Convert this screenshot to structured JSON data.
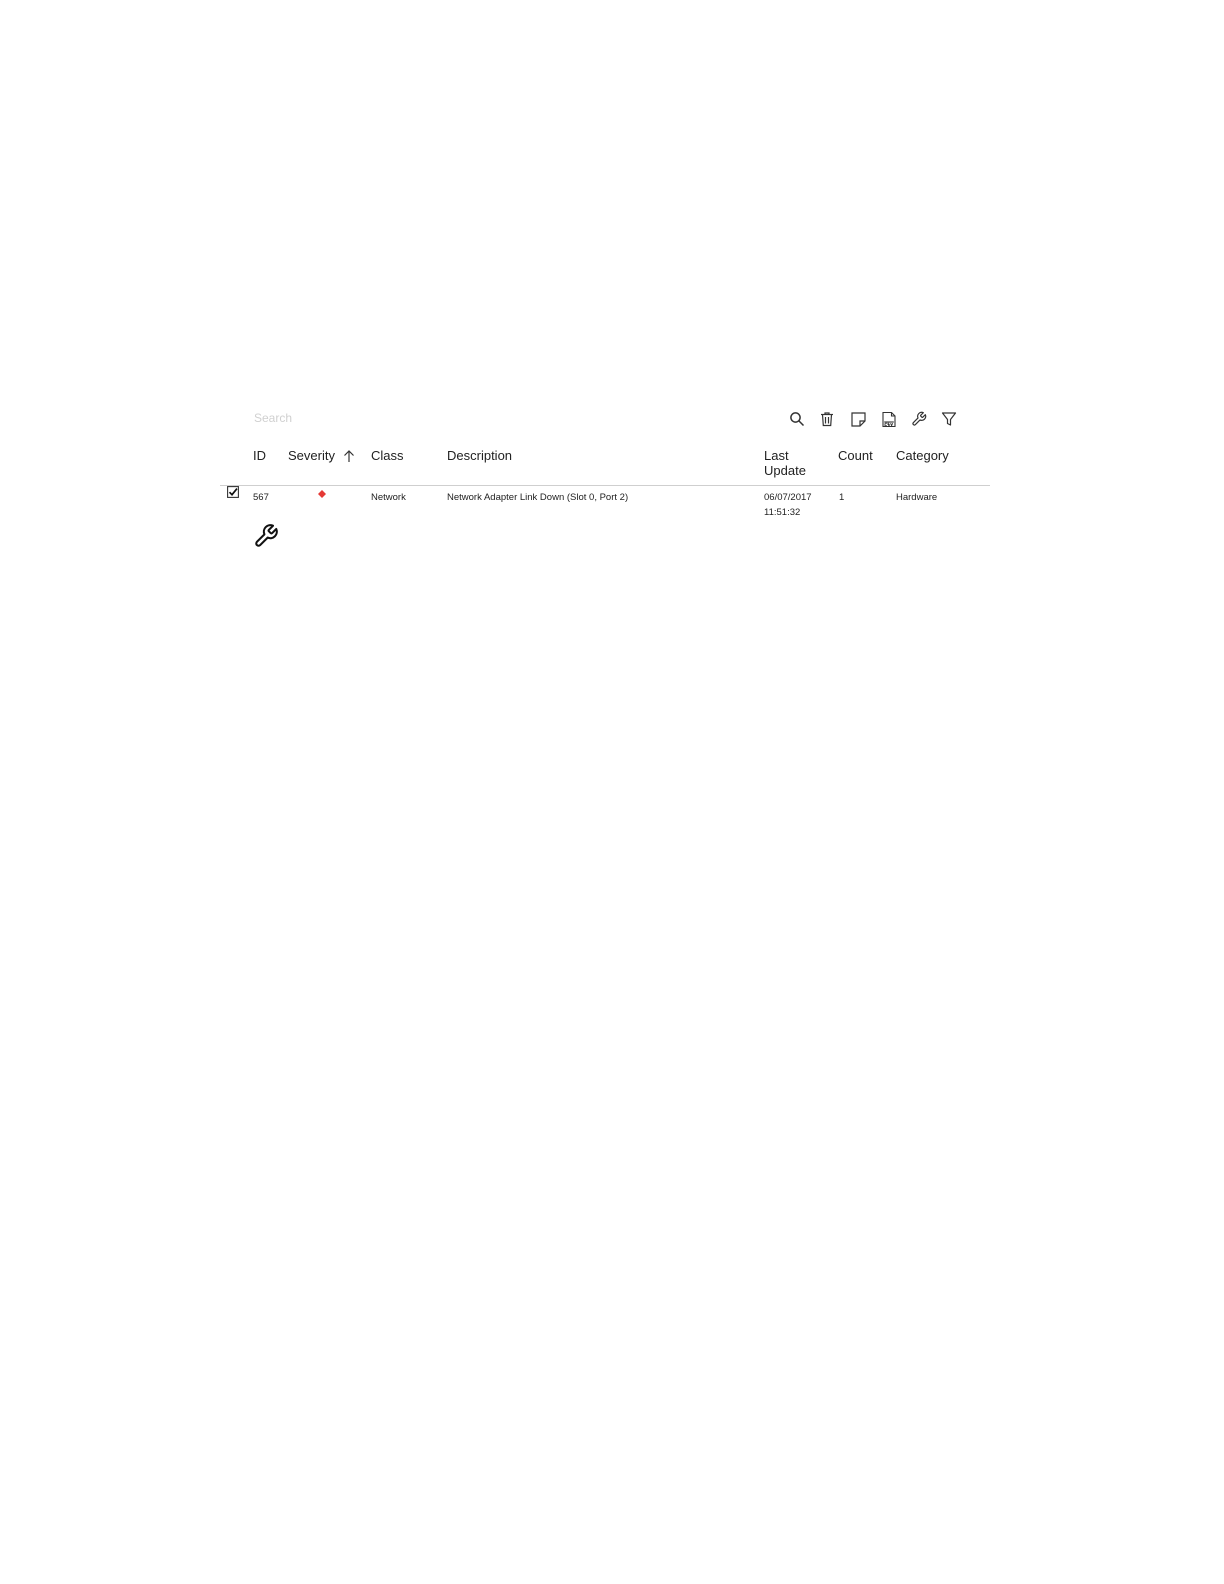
{
  "search": {
    "placeholder": "Search"
  },
  "toolbar": {
    "icons": [
      "search-icon",
      "trash-icon",
      "note-icon",
      "csv-export-icon",
      "wrench-icon",
      "filter-icon"
    ]
  },
  "table": {
    "columns": [
      "ID",
      "Severity",
      "Class",
      "Description",
      "Last Update",
      "Count",
      "Category"
    ],
    "sort": {
      "column": "Severity",
      "direction": "ascending"
    },
    "rows": [
      {
        "checked": true,
        "id": "567",
        "severity_icon": "critical-diamond-icon",
        "class": "Network",
        "description": "Network Adapter Link Down (Slot 0, Port 2)",
        "last_update": "06/07/2017 11:51:32",
        "count": "1",
        "category": "Hardware"
      }
    ]
  },
  "colors": {
    "severity_critical": "#e53935",
    "header_rule": "#cfcfcf",
    "placeholder": "#d0d0d0",
    "icon": "#333333"
  }
}
